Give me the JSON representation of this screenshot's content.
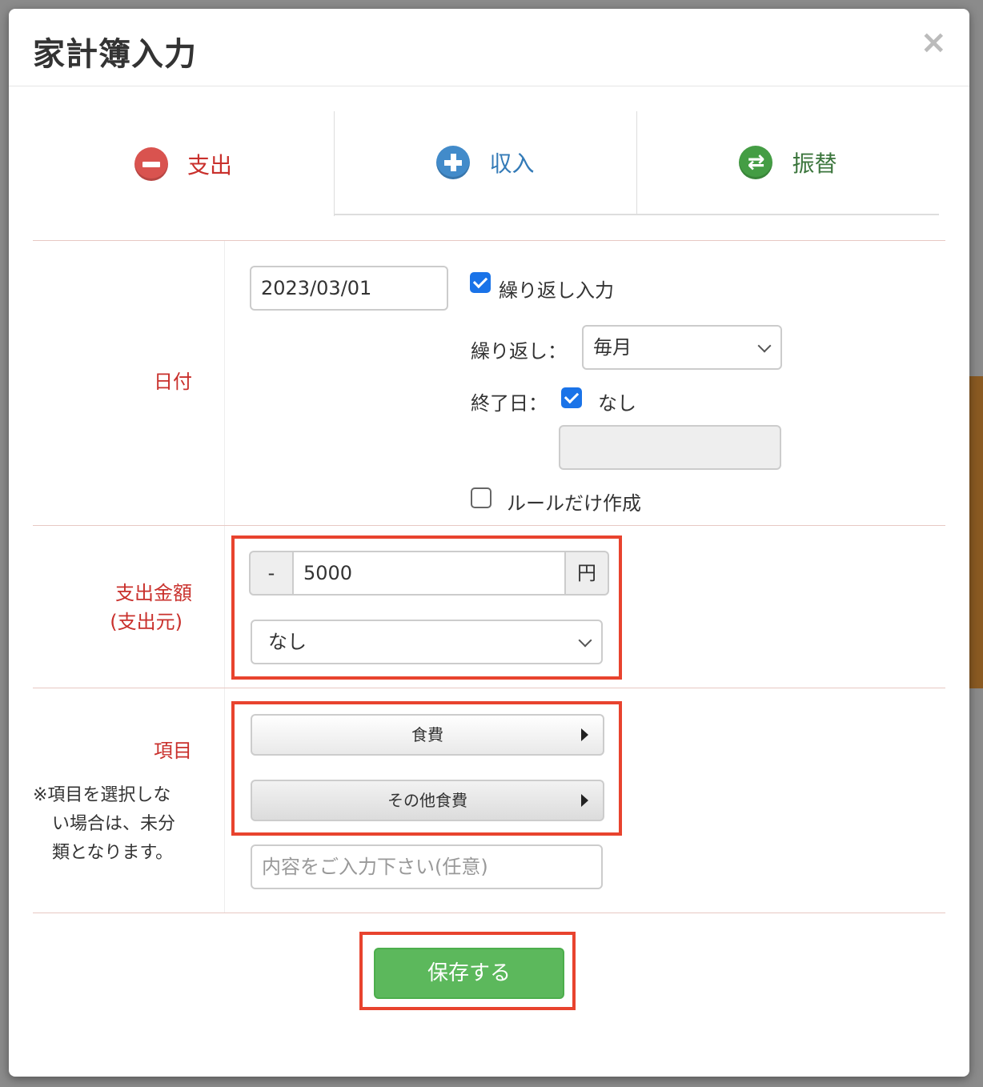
{
  "modal": {
    "title": "家計簿入力",
    "close_label": "×"
  },
  "tabs": [
    {
      "label": "支出",
      "icon": "minus-circle-icon",
      "color": "#c9302c"
    },
    {
      "label": "収入",
      "icon": "plus-circle-icon",
      "color": "#337ab7"
    },
    {
      "label": "振替",
      "icon": "swap-circle-icon",
      "color": "#3c763d"
    }
  ],
  "date_row": {
    "label": "日付",
    "date_value": "2023/03/01",
    "repeat_checkbox_label": "繰り返し入力",
    "repeat_checked": true,
    "repeat_label": "繰り返し：",
    "repeat_value": "毎月",
    "end_date_label": "終了日：",
    "end_date_none_checked": true,
    "end_date_none_label": "なし",
    "end_date_value": "",
    "rule_only_label": "ルールだけ作成",
    "rule_only_checked": false
  },
  "amount_row": {
    "label_line1": "支出金額",
    "label_line2": "(支出元)",
    "sign": "-",
    "amount": "5000",
    "currency": "円",
    "source_value": "なし"
  },
  "category_row": {
    "label": "項目",
    "note_line1": "※項目を選択しな",
    "note_line2": "い場合は、未分",
    "note_line3": "類となります。",
    "category": "食費",
    "subcategory": "その他食費",
    "memo_placeholder": "内容をご入力下さい(任意)"
  },
  "save_label": "保存する",
  "colors": {
    "accent_red": "#c9302c",
    "highlight": "#e8432e",
    "save_green": "#5cb85c"
  }
}
